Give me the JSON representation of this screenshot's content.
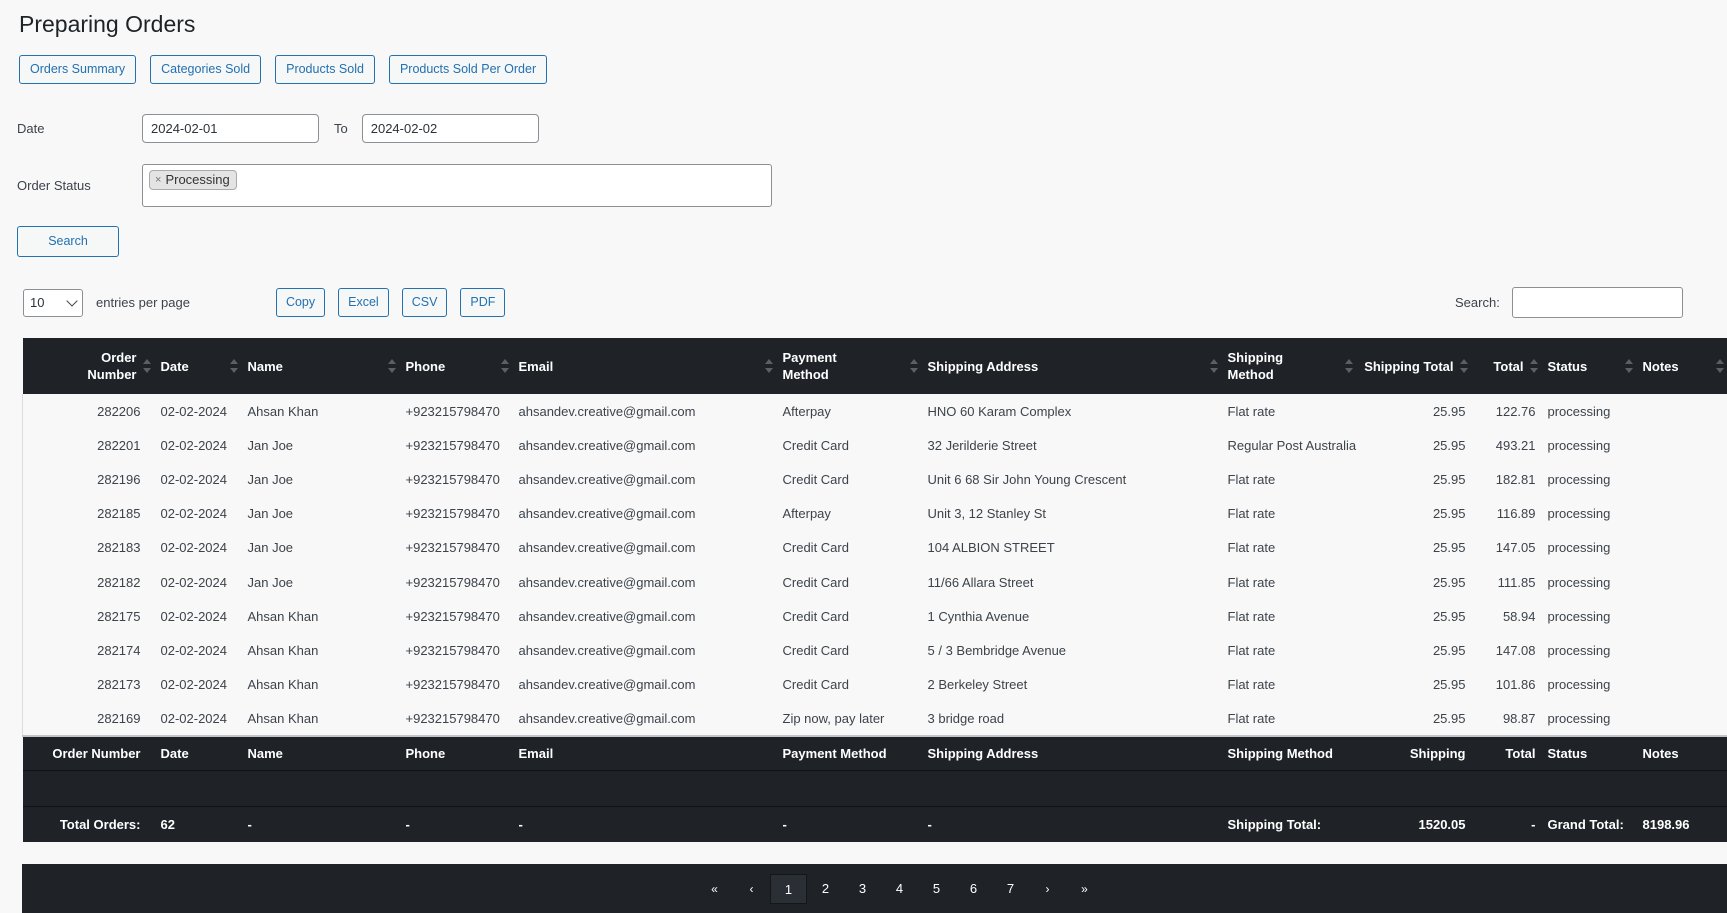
{
  "page_title": "Preparing Orders",
  "nav_buttons": [
    "Orders Summary",
    "Categories Sold",
    "Products Sold",
    "Products Sold Per Order"
  ],
  "filters": {
    "date_label": "Date",
    "date_from": "2024-02-01",
    "to_label": "To",
    "date_to": "2024-02-02",
    "status_label": "Order Status",
    "status_chips": [
      {
        "remove": "×",
        "label": "Processing"
      }
    ],
    "search_button": "Search"
  },
  "controls": {
    "entries_value": "10",
    "entries_label": "entries per page",
    "export_buttons": [
      "Copy",
      "Excel",
      "CSV",
      "PDF"
    ],
    "search_label": "Search:",
    "search_value": ""
  },
  "table": {
    "columns": [
      "Order Number",
      "Date",
      "Name",
      "Phone",
      "Email",
      "Payment Method",
      "Shipping Address",
      "Shipping Method",
      "Shipping Total",
      "Total",
      "Status",
      "Notes"
    ],
    "rows": [
      [
        "282206",
        "02-02-2024",
        "Ahsan Khan",
        "+923215798470",
        "ahsandev.creative@gmail.com",
        "Afterpay",
        "HNO 60 Karam Complex",
        "Flat rate",
        "25.95",
        "122.76",
        "processing",
        ""
      ],
      [
        "282201",
        "02-02-2024",
        "Jan Joe",
        "+923215798470",
        "ahsandev.creative@gmail.com",
        "Credit Card",
        "32 Jerilderie Street",
        "Regular Post Australia",
        "25.95",
        "493.21",
        "processing",
        ""
      ],
      [
        "282196",
        "02-02-2024",
        "Jan Joe",
        "+923215798470",
        "ahsandev.creative@gmail.com",
        "Credit Card",
        "Unit 6 68 Sir John Young Crescent",
        "Flat rate",
        "25.95",
        "182.81",
        "processing",
        ""
      ],
      [
        "282185",
        "02-02-2024",
        "Jan Joe",
        "+923215798470",
        "ahsandev.creative@gmail.com",
        "Afterpay",
        "Unit 3, 12 Stanley St",
        "Flat rate",
        "25.95",
        "116.89",
        "processing",
        ""
      ],
      [
        "282183",
        "02-02-2024",
        "Jan Joe",
        "+923215798470",
        "ahsandev.creative@gmail.com",
        "Credit Card",
        "104 ALBION STREET",
        "Flat rate",
        "25.95",
        "147.05",
        "processing",
        ""
      ],
      [
        "282182",
        "02-02-2024",
        "Jan Joe",
        "+923215798470",
        "ahsandev.creative@gmail.com",
        "Credit Card",
        "11/66 Allara Street",
        "Flat rate",
        "25.95",
        "111.85",
        "processing",
        ""
      ],
      [
        "282175",
        "02-02-2024",
        "Ahsan Khan",
        "+923215798470",
        "ahsandev.creative@gmail.com",
        "Credit Card",
        "1 Cynthia Avenue",
        "Flat rate",
        "25.95",
        "58.94",
        "processing",
        ""
      ],
      [
        "282174",
        "02-02-2024",
        "Ahsan Khan",
        "+923215798470",
        "ahsandev.creative@gmail.com",
        "Credit Card",
        "5 / 3 Bembridge Avenue",
        "Flat rate",
        "25.95",
        "147.08",
        "processing",
        ""
      ],
      [
        "282173",
        "02-02-2024",
        "Ahsan Khan",
        "+923215798470",
        "ahsandev.creative@gmail.com",
        "Credit Card",
        "2 Berkeley Street",
        "Flat rate",
        "25.95",
        "101.86",
        "processing",
        ""
      ],
      [
        "282169",
        "02-02-2024",
        "Ahsan Khan",
        "+923215798470",
        "ahsandev.creative@gmail.com",
        "Zip now, pay later",
        "3 bridge road",
        "Flat rate",
        "25.95",
        "98.87",
        "processing",
        ""
      ]
    ],
    "footer_columns": [
      "Order Number",
      "Date",
      "Name",
      "Phone",
      "Email",
      "Payment Method",
      "Shipping Address",
      "Shipping Method",
      "Shipping",
      "Total",
      "Status",
      "Notes"
    ],
    "totals_row": [
      "Total Orders:",
      "62",
      "-",
      "-",
      "-",
      "-",
      "-",
      "Shipping Total:",
      "1520.05",
      "-",
      "Grand Total:",
      "8198.96"
    ]
  },
  "pagination": {
    "first": "«",
    "prev": "‹",
    "pages": [
      "1",
      "2",
      "3",
      "4",
      "5",
      "6",
      "7"
    ],
    "current": "1",
    "next": "›",
    "last": "»"
  }
}
